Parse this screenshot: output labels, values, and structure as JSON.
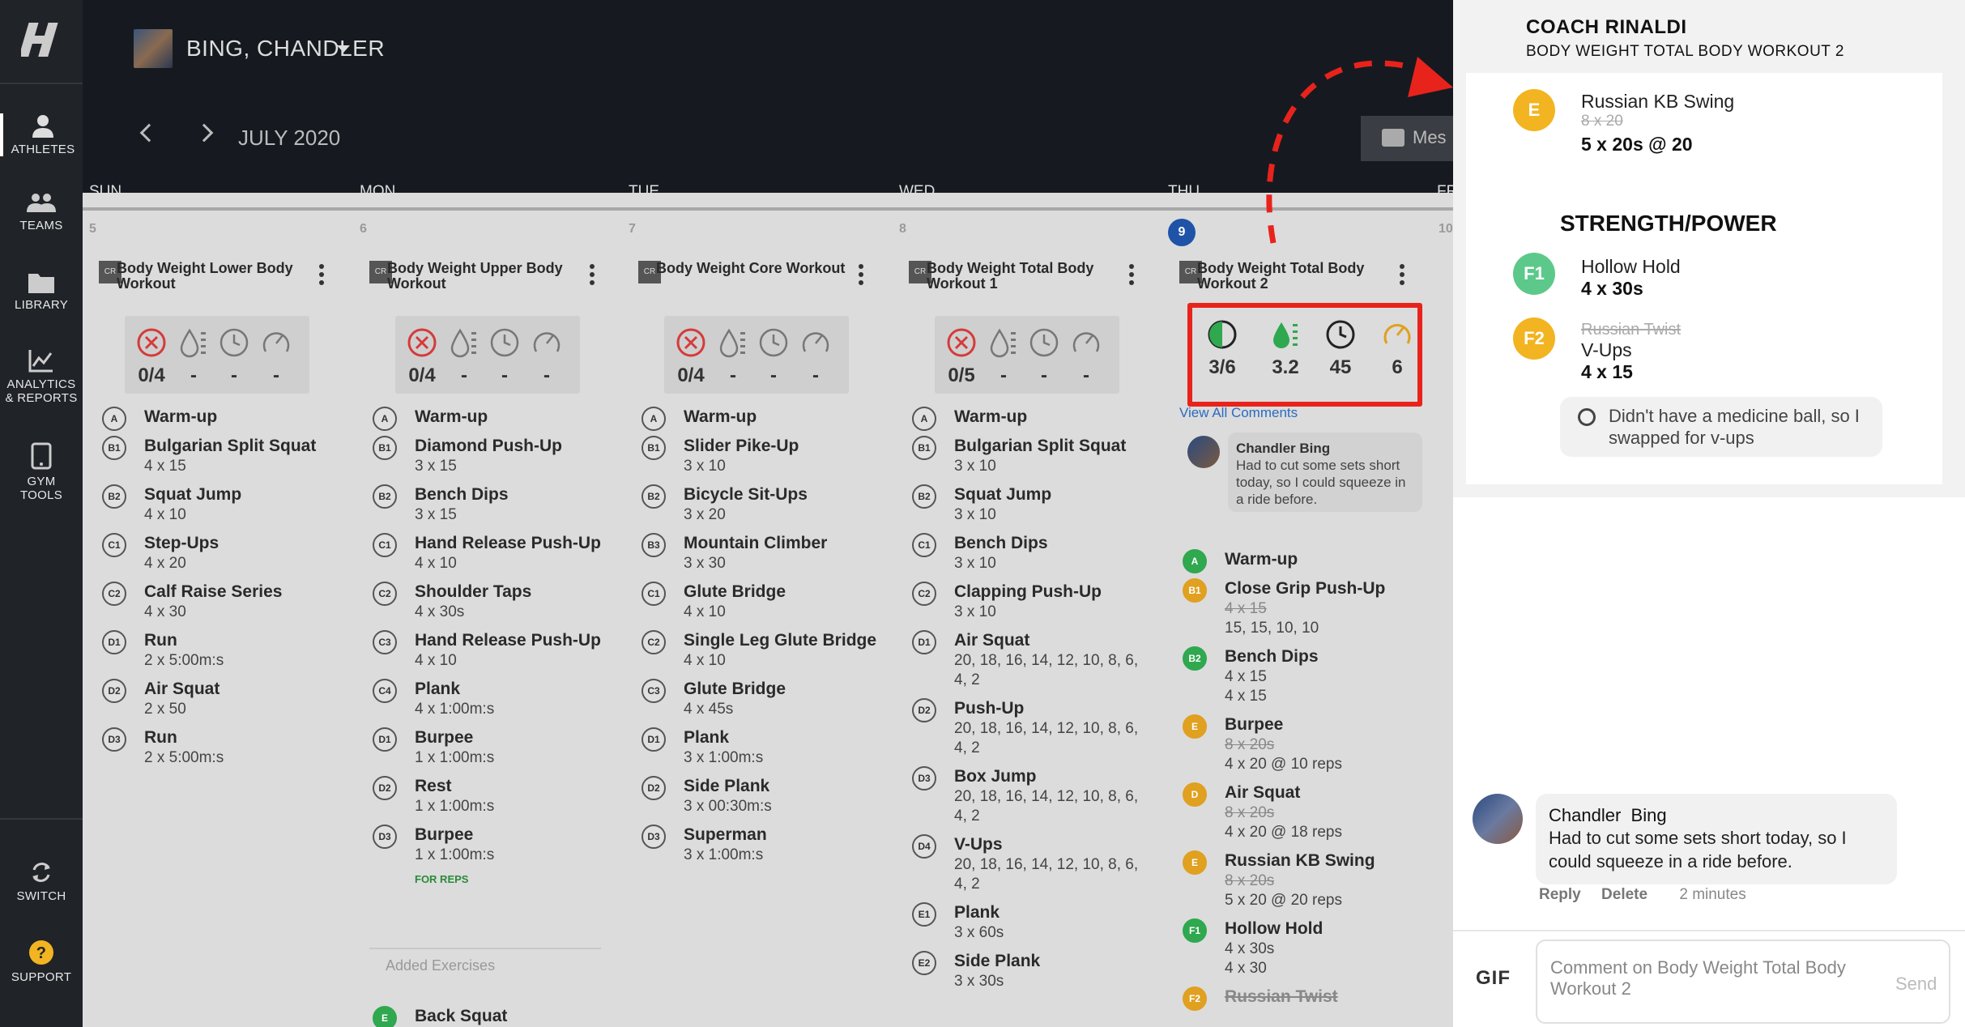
{
  "sidebar": {
    "items": [
      {
        "label": "ATHLETES",
        "icon": "person-icon"
      },
      {
        "label": "TEAMS",
        "icon": "group-icon"
      },
      {
        "label": "LIBRARY",
        "icon": "folder-icon"
      },
      {
        "label": "ANALYTICS",
        "label2": "& REPORTS",
        "icon": "chart-icon"
      },
      {
        "label": "GYM",
        "label2": "TOOLS",
        "icon": "tablet-icon"
      },
      {
        "label": "SWITCH",
        "icon": "switch-icon"
      },
      {
        "label": "SUPPORT",
        "icon": "help-icon"
      }
    ]
  },
  "header": {
    "athlete": "BING, CHANDLER",
    "month": "JULY 2020",
    "message_label": "Mes"
  },
  "days": [
    "SUN",
    "MON",
    "TUE",
    "WED",
    "THU",
    "FR"
  ],
  "workouts": [
    {
      "day": "5",
      "title": "Body Weight Lower Body Workout",
      "stats": [
        "0/4",
        "-",
        "-",
        "-"
      ],
      "exercises": [
        {
          "b": "A",
          "n": "Warm-up",
          "s": ""
        },
        {
          "b": "B1",
          "n": "Bulgarian Split Squat",
          "s": "4 x 15"
        },
        {
          "b": "B2",
          "n": "Squat Jump",
          "s": "4 x 10"
        },
        {
          "b": "C1",
          "n": "Step-Ups",
          "s": "4 x 20"
        },
        {
          "b": "C2",
          "n": "Calf Raise Series",
          "s": "4 x 30"
        },
        {
          "b": "D1",
          "n": "Run",
          "s": "2 x 5:00m:s"
        },
        {
          "b": "D2",
          "n": "Air Squat",
          "s": "2 x 50"
        },
        {
          "b": "D3",
          "n": "Run",
          "s": "2 x 5:00m:s"
        }
      ]
    },
    {
      "day": "6",
      "title": "Body Weight Upper Body Workout",
      "stats": [
        "0/4",
        "-",
        "-",
        "-"
      ],
      "exercises": [
        {
          "b": "A",
          "n": "Warm-up",
          "s": ""
        },
        {
          "b": "B1",
          "n": "Diamond Push-Up",
          "s": "3 x 15"
        },
        {
          "b": "B2",
          "n": "Bench Dips",
          "s": "3 x 15"
        },
        {
          "b": "C1",
          "n": "Hand Release Push-Up",
          "s": "4 x 10"
        },
        {
          "b": "C2",
          "n": "Shoulder Taps",
          "s": "4 x 30s"
        },
        {
          "b": "C3",
          "n": "Hand Release Push-Up",
          "s": "4 x 10"
        },
        {
          "b": "C4",
          "n": "Plank",
          "s": "4 x 1:00m:s"
        },
        {
          "b": "D1",
          "n": "Burpee",
          "s": "1 x 1:00m:s"
        },
        {
          "b": "D2",
          "n": "Rest",
          "s": "1 x 1:00m:s"
        },
        {
          "b": "D3",
          "n": "Burpee",
          "s": "1 x 1:00m:s"
        }
      ],
      "for_reps": "FOR REPS",
      "added_label": "Added Exercises",
      "added": {
        "b": "E",
        "n": "Back Squat"
      }
    },
    {
      "day": "7",
      "title": "Body Weight Core Workout",
      "stats": [
        "0/4",
        "-",
        "-",
        "-"
      ],
      "exercises": [
        {
          "b": "A",
          "n": "Warm-up",
          "s": ""
        },
        {
          "b": "B1",
          "n": "Slider Pike-Up",
          "s": "3 x 10"
        },
        {
          "b": "B2",
          "n": "Bicycle Sit-Ups",
          "s": "3 x 20"
        },
        {
          "b": "B3",
          "n": "Mountain Climber",
          "s": "3 x 30"
        },
        {
          "b": "C1",
          "n": "Glute Bridge",
          "s": "4 x 10"
        },
        {
          "b": "C2",
          "n": "Single Leg Glute Bridge",
          "s": "4 x 10"
        },
        {
          "b": "C3",
          "n": "Glute Bridge",
          "s": "4 x 45s"
        },
        {
          "b": "D1",
          "n": "Plank",
          "s": "3 x 1:00m:s"
        },
        {
          "b": "D2",
          "n": "Side Plank",
          "s": "3 x 00:30m:s"
        },
        {
          "b": "D3",
          "n": "Superman",
          "s": "3 x 1:00m:s"
        }
      ]
    },
    {
      "day": "8",
      "title": "Body Weight Total Body Workout 1",
      "stats": [
        "0/5",
        "-",
        "-",
        "-"
      ],
      "exercises": [
        {
          "b": "A",
          "n": "Warm-up",
          "s": ""
        },
        {
          "b": "B1",
          "n": "Bulgarian Split Squat",
          "s": "3 x 10"
        },
        {
          "b": "B2",
          "n": "Squat Jump",
          "s": "3 x 10"
        },
        {
          "b": "C1",
          "n": "Bench Dips",
          "s": "3 x 10"
        },
        {
          "b": "C2",
          "n": "Clapping Push-Up",
          "s": "3 x 10"
        },
        {
          "b": "D1",
          "n": "Air Squat",
          "s": "20, 18, 16, 14, 12, 10, 8, 6, 4, 2"
        },
        {
          "b": "D2",
          "n": "Push-Up",
          "s": "20, 18, 16, 14, 12, 10, 8, 6, 4, 2"
        },
        {
          "b": "D3",
          "n": "Box Jump",
          "s": "20, 18, 16, 14, 12, 10, 8, 6, 4, 2"
        },
        {
          "b": "D4",
          "n": "V-Ups",
          "s": "20, 18, 16, 14, 12, 10, 8, 6, 4, 2"
        },
        {
          "b": "E1",
          "n": "Plank",
          "s": "3 x 60s"
        },
        {
          "b": "E2",
          "n": "Side Plank",
          "s": "3 x 30s"
        }
      ]
    },
    {
      "day": "9",
      "title": "Body Weight Total Body Workout 2",
      "stats": [
        "3/6",
        "3.2",
        "45",
        "6"
      ],
      "view_all": "View All Comments",
      "comment": {
        "name": "Chandler Bing",
        "text": "Had to cut some sets short today, so I could squeeze in a ride before."
      },
      "exercises": [
        {
          "b": "A",
          "n": "Warm-up",
          "old": "",
          "s": "",
          "c": "g"
        },
        {
          "b": "B1",
          "n": "Close Grip Push-Up",
          "old": "4 x 15",
          "s": "15, 15, 10, 10",
          "c": "o"
        },
        {
          "b": "B2",
          "n": "Bench Dips",
          "old": "",
          "s": "4 x 15",
          "s2": "4 x 15",
          "c": "g"
        },
        {
          "b": "E",
          "n": "Burpee",
          "old": "8 x 20s",
          "s": "4 x 20 @ 10 reps",
          "c": "o"
        },
        {
          "b": "D",
          "n": "Air Squat",
          "old": "8 x 20s",
          "s": "4 x 20 @ 18 reps",
          "c": "o"
        },
        {
          "b": "E",
          "n": "Russian KB Swing",
          "old": "8 x 20s",
          "s": "5 x 20 @ 20 reps",
          "c": "o"
        },
        {
          "b": "F1",
          "n": "Hollow Hold",
          "old": "",
          "s": "4 x 30s",
          "s2": "4 x 30",
          "c": "g"
        },
        {
          "b": "F2",
          "n": "Russian Twist",
          "old": "",
          "s": "",
          "c": "o",
          "strike": true
        }
      ]
    },
    {
      "day": "10"
    }
  ],
  "panel": {
    "coach": "COACH RINALDI",
    "workout": "BODY WEIGHT TOTAL BODY WORKOUT 2",
    "ex_e": {
      "badge": "E",
      "name": "Russian KB Swing",
      "old": "8 x 20",
      "result": "5 x 20s @ 20"
    },
    "section": "STRENGTH/POWER",
    "ex_f1": {
      "badge": "F1",
      "name": "Hollow Hold",
      "result": "4 x 30s"
    },
    "ex_f2": {
      "badge": "F2",
      "old_name": "Russian Twist",
      "name": "V-Ups",
      "result": "4 x 15"
    },
    "note": "Didn't have a medicine ball, so I swapped for v-ups",
    "chat": {
      "first": "Chandler",
      "last": "Bing",
      "text": "Had to cut some sets short today, so I could squeeze in a ride before.",
      "reply": "Reply",
      "delete": "Delete",
      "time": "2 minutes"
    },
    "gif": "GIF",
    "placeholder": "Comment on Body Weight Total Body Workout 2",
    "send": "Send"
  },
  "colors": {
    "highlight": "#e8231c",
    "green": "#2fa84f",
    "orange": "#e0a020",
    "today": "#1e53a8"
  }
}
